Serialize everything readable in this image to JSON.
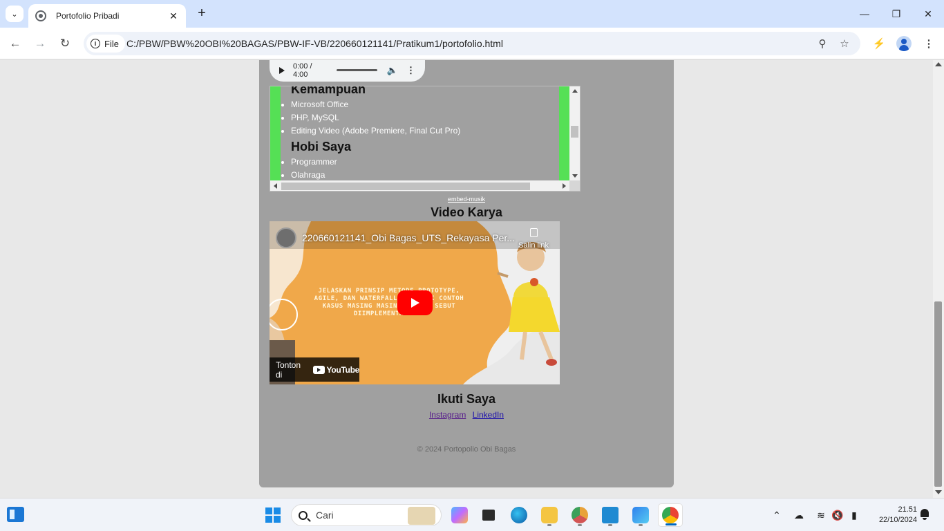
{
  "browser": {
    "tab_title": "Portofolio Pribadi",
    "scheme_chip": "File",
    "url": "C:/PBW/PBW%20OBI%20BAGAS/PBW-IF-VB/220660121141/Pratikum1/portofolio.html",
    "icons": [
      "tab-search-icon",
      "favicon-icon",
      "close-icon",
      "new-tab-icon",
      "minimize-icon",
      "restore-icon",
      "window-close-icon",
      "back-icon",
      "forward-icon",
      "reload-icon",
      "info-icon",
      "zoom-icon",
      "bookmark-star-icon",
      "performance-icon",
      "profile-icon",
      "more-menu-icon"
    ]
  },
  "page": {
    "audio": {
      "time": "0:00 / 4:00"
    },
    "iframe": {
      "heading_skills": "Kemampuan",
      "skills": [
        "Microsoft Office",
        "PHP, MySQL",
        "Editing Video (Adobe Premiere, Final Cut Pro)"
      ],
      "heading_hobby": "Hobi Saya",
      "hobbies": [
        "Programmer",
        "Olahraga"
      ],
      "accent_color": "#55e055"
    },
    "embed_link": "embed-musik",
    "video_section_title": "Video Karya",
    "video": {
      "title": "220660121141_Obi Bagas_UTS_Rekayasa Per...",
      "copy_link": "Salin link",
      "thumbnail_text": "JELASKAN PRINSIP METODE PROTOTYPE, AGILE, DAN WATERFALL DAN BERI CONTOH KASUS MASING MASING PROSES SEBUT DIIMPLEMENTASIKAN",
      "watch_on": "Tonton di",
      "youtube": "YouTube"
    },
    "follow_title": "Ikuti Saya",
    "links": {
      "instagram": "Instagram",
      "linkedin": "LinkedIn"
    },
    "footer": "© 2024 Portopolio Obi Bagas",
    "background_color": "#a0a0a0"
  },
  "taskbar": {
    "search_placeholder": "Cari",
    "apps": [
      "copilot-pre",
      "task-view",
      "edge",
      "file-explorer",
      "chrome-canary",
      "vs-code",
      "snipping-tool",
      "chrome"
    ],
    "time": "21.51",
    "date": "22/10/2024"
  }
}
